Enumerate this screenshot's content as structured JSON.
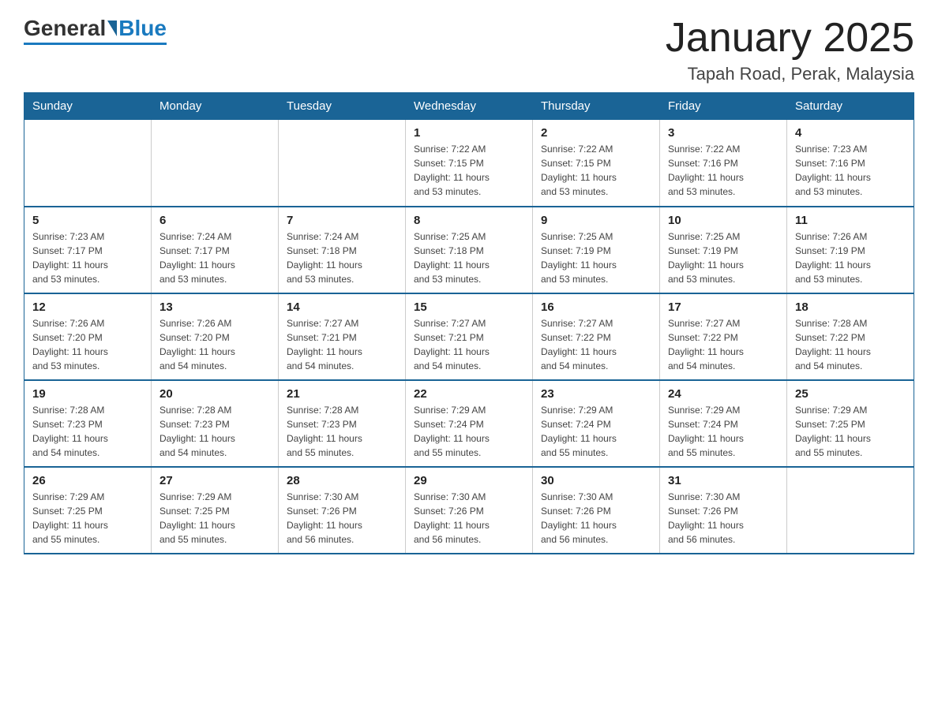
{
  "header": {
    "logo": {
      "general": "General",
      "blue": "Blue"
    },
    "title": "January 2025",
    "location": "Tapah Road, Perak, Malaysia"
  },
  "weekdays": [
    "Sunday",
    "Monday",
    "Tuesday",
    "Wednesday",
    "Thursday",
    "Friday",
    "Saturday"
  ],
  "weeks": [
    [
      {
        "day": "",
        "info": ""
      },
      {
        "day": "",
        "info": ""
      },
      {
        "day": "",
        "info": ""
      },
      {
        "day": "1",
        "info": "Sunrise: 7:22 AM\nSunset: 7:15 PM\nDaylight: 11 hours\nand 53 minutes."
      },
      {
        "day": "2",
        "info": "Sunrise: 7:22 AM\nSunset: 7:15 PM\nDaylight: 11 hours\nand 53 minutes."
      },
      {
        "day": "3",
        "info": "Sunrise: 7:22 AM\nSunset: 7:16 PM\nDaylight: 11 hours\nand 53 minutes."
      },
      {
        "day": "4",
        "info": "Sunrise: 7:23 AM\nSunset: 7:16 PM\nDaylight: 11 hours\nand 53 minutes."
      }
    ],
    [
      {
        "day": "5",
        "info": "Sunrise: 7:23 AM\nSunset: 7:17 PM\nDaylight: 11 hours\nand 53 minutes."
      },
      {
        "day": "6",
        "info": "Sunrise: 7:24 AM\nSunset: 7:17 PM\nDaylight: 11 hours\nand 53 minutes."
      },
      {
        "day": "7",
        "info": "Sunrise: 7:24 AM\nSunset: 7:18 PM\nDaylight: 11 hours\nand 53 minutes."
      },
      {
        "day": "8",
        "info": "Sunrise: 7:25 AM\nSunset: 7:18 PM\nDaylight: 11 hours\nand 53 minutes."
      },
      {
        "day": "9",
        "info": "Sunrise: 7:25 AM\nSunset: 7:19 PM\nDaylight: 11 hours\nand 53 minutes."
      },
      {
        "day": "10",
        "info": "Sunrise: 7:25 AM\nSunset: 7:19 PM\nDaylight: 11 hours\nand 53 minutes."
      },
      {
        "day": "11",
        "info": "Sunrise: 7:26 AM\nSunset: 7:19 PM\nDaylight: 11 hours\nand 53 minutes."
      }
    ],
    [
      {
        "day": "12",
        "info": "Sunrise: 7:26 AM\nSunset: 7:20 PM\nDaylight: 11 hours\nand 53 minutes."
      },
      {
        "day": "13",
        "info": "Sunrise: 7:26 AM\nSunset: 7:20 PM\nDaylight: 11 hours\nand 54 minutes."
      },
      {
        "day": "14",
        "info": "Sunrise: 7:27 AM\nSunset: 7:21 PM\nDaylight: 11 hours\nand 54 minutes."
      },
      {
        "day": "15",
        "info": "Sunrise: 7:27 AM\nSunset: 7:21 PM\nDaylight: 11 hours\nand 54 minutes."
      },
      {
        "day": "16",
        "info": "Sunrise: 7:27 AM\nSunset: 7:22 PM\nDaylight: 11 hours\nand 54 minutes."
      },
      {
        "day": "17",
        "info": "Sunrise: 7:27 AM\nSunset: 7:22 PM\nDaylight: 11 hours\nand 54 minutes."
      },
      {
        "day": "18",
        "info": "Sunrise: 7:28 AM\nSunset: 7:22 PM\nDaylight: 11 hours\nand 54 minutes."
      }
    ],
    [
      {
        "day": "19",
        "info": "Sunrise: 7:28 AM\nSunset: 7:23 PM\nDaylight: 11 hours\nand 54 minutes."
      },
      {
        "day": "20",
        "info": "Sunrise: 7:28 AM\nSunset: 7:23 PM\nDaylight: 11 hours\nand 54 minutes."
      },
      {
        "day": "21",
        "info": "Sunrise: 7:28 AM\nSunset: 7:23 PM\nDaylight: 11 hours\nand 55 minutes."
      },
      {
        "day": "22",
        "info": "Sunrise: 7:29 AM\nSunset: 7:24 PM\nDaylight: 11 hours\nand 55 minutes."
      },
      {
        "day": "23",
        "info": "Sunrise: 7:29 AM\nSunset: 7:24 PM\nDaylight: 11 hours\nand 55 minutes."
      },
      {
        "day": "24",
        "info": "Sunrise: 7:29 AM\nSunset: 7:24 PM\nDaylight: 11 hours\nand 55 minutes."
      },
      {
        "day": "25",
        "info": "Sunrise: 7:29 AM\nSunset: 7:25 PM\nDaylight: 11 hours\nand 55 minutes."
      }
    ],
    [
      {
        "day": "26",
        "info": "Sunrise: 7:29 AM\nSunset: 7:25 PM\nDaylight: 11 hours\nand 55 minutes."
      },
      {
        "day": "27",
        "info": "Sunrise: 7:29 AM\nSunset: 7:25 PM\nDaylight: 11 hours\nand 55 minutes."
      },
      {
        "day": "28",
        "info": "Sunrise: 7:30 AM\nSunset: 7:26 PM\nDaylight: 11 hours\nand 56 minutes."
      },
      {
        "day": "29",
        "info": "Sunrise: 7:30 AM\nSunset: 7:26 PM\nDaylight: 11 hours\nand 56 minutes."
      },
      {
        "day": "30",
        "info": "Sunrise: 7:30 AM\nSunset: 7:26 PM\nDaylight: 11 hours\nand 56 minutes."
      },
      {
        "day": "31",
        "info": "Sunrise: 7:30 AM\nSunset: 7:26 PM\nDaylight: 11 hours\nand 56 minutes."
      },
      {
        "day": "",
        "info": ""
      }
    ]
  ]
}
